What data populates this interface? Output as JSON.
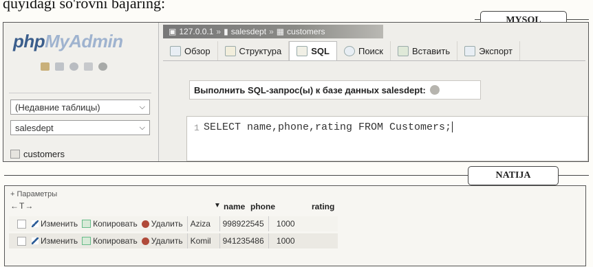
{
  "intro_text": "quyidagi so'rovni bajaring:",
  "callouts": {
    "mysql": "MYSQL",
    "natija": "NATIJA"
  },
  "sidebar": {
    "logo_php": "php",
    "logo_rest": "MyAdmin",
    "recent_tables": "(Недавние таблицы)",
    "database": "salesdept",
    "tree_item": "customers"
  },
  "breadcrumb": {
    "server": "127.0.0.1",
    "database": "salesdept",
    "table": "customers"
  },
  "tabs": [
    {
      "label": "Обзор",
      "icon": "browse-icon"
    },
    {
      "label": "Структура",
      "icon": "structure-icon"
    },
    {
      "label": "SQL",
      "icon": "sql-icon",
      "active": true
    },
    {
      "label": "Поиск",
      "icon": "search-icon"
    },
    {
      "label": "Вставить",
      "icon": "insert-icon"
    },
    {
      "label": "Экспорт",
      "icon": "export-icon"
    }
  ],
  "query_header": "Выполнить SQL-запрос(ы) к базе данных salesdept:",
  "editor": {
    "line_number": "1",
    "code": "SELECT name,phone,rating FROM Customers;"
  },
  "result": {
    "params_label": "+ Параметры",
    "arrows": "←T→",
    "sort_arrow": "▼",
    "columns": [
      "name",
      "phone",
      "rating"
    ],
    "actions": {
      "edit": "Изменить",
      "copy": "Копировать",
      "delete": "Удалить"
    },
    "rows": [
      {
        "name": "Aziza",
        "phone": "998922545",
        "rating": "1000"
      },
      {
        "name": "Komil",
        "phone": "941235486",
        "rating": "1000"
      }
    ]
  }
}
